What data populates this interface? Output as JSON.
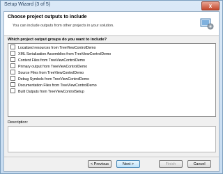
{
  "window": {
    "title": "Setup Wizard (3 of 5)",
    "close_glyph": "x"
  },
  "header": {
    "title": "Choose project outputs to include",
    "subtitle": "You can include outputs from other projects in your solution."
  },
  "outputs": {
    "label": "Which project output groups do you want to include?",
    "items": [
      {
        "label": "Localized resources from TreeViewControlDemo",
        "checked": false
      },
      {
        "label": "XML Serialization Assemblies from TreeViewControlDemo",
        "checked": false
      },
      {
        "label": "Content Files from TreeViewControlDemo",
        "checked": false
      },
      {
        "label": "Primary output from TreeViewControlDemo",
        "checked": false
      },
      {
        "label": "Source Files from TreeViewControlDemo",
        "checked": false
      },
      {
        "label": "Debug Symbols from TreeViewControlDemo",
        "checked": false
      },
      {
        "label": "Documentation Files from TreeViewControlDemo",
        "checked": false
      },
      {
        "label": "Built Outputs from TreeViewControlSetup",
        "checked": false
      }
    ]
  },
  "description": {
    "label": "Description:",
    "text": ""
  },
  "buttons": {
    "previous": "< Previous",
    "next": "Next >",
    "finish": "Finish",
    "cancel": "Cancel"
  }
}
